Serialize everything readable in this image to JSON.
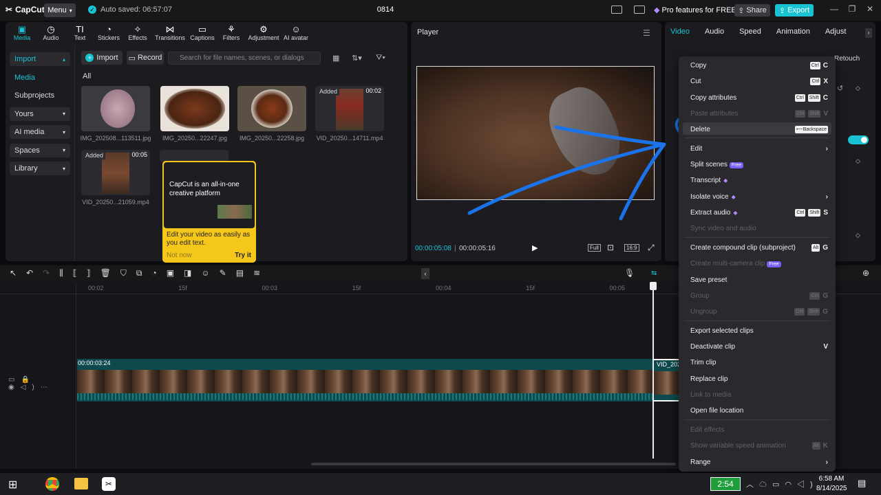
{
  "titlebar": {
    "logo": "CapCut",
    "menu_label": "Menu",
    "autosave": "Auto saved: 06:57:07",
    "project_name": "0814",
    "pro_features": "Pro features for FREE",
    "share": "Share",
    "export": "Export"
  },
  "tools": [
    {
      "label": "Media",
      "icon": "media-icon"
    },
    {
      "label": "Audio",
      "icon": "audio-icon"
    },
    {
      "label": "Text",
      "icon": "text-icon"
    },
    {
      "label": "Stickers",
      "icon": "stickers-icon"
    },
    {
      "label": "Effects",
      "icon": "effects-icon"
    },
    {
      "label": "Transitions",
      "icon": "transitions-icon"
    },
    {
      "label": "Captions",
      "icon": "captions-icon"
    },
    {
      "label": "Filters",
      "icon": "filters-icon"
    },
    {
      "label": "Adjustment",
      "icon": "adjustment-icon"
    },
    {
      "label": "AI avatar",
      "icon": "ai-avatar-icon"
    }
  ],
  "sidebar": {
    "items": [
      "Import",
      "Media",
      "Subprojects",
      "Yours",
      "AI media",
      "Spaces",
      "Library"
    ]
  },
  "media": {
    "import": "Import",
    "record": "Record",
    "search_placeholder": "Search for file names, scenes, or dialogs",
    "all": "All",
    "files": [
      {
        "name": "IMG_202508...113511.jpg",
        "added": "",
        "duration": ""
      },
      {
        "name": "IMG_20250...22247.jpg",
        "added": "",
        "duration": ""
      },
      {
        "name": "IMG_20250...22258.jpg",
        "added": "",
        "duration": ""
      },
      {
        "name": "VID_20250...14711.mp4",
        "added": "Added",
        "duration": "00:02"
      },
      {
        "name": "VID_20250...21059.mp4",
        "added": "Added",
        "duration": "00:05"
      }
    ]
  },
  "tooltip": {
    "headline": "CapCut is an all-in-one creative platform",
    "body": "Edit your video as easily as you edit text.",
    "not_now": "Not now",
    "try_it": "Try it"
  },
  "player": {
    "title": "Player",
    "current": "00:00:05:08",
    "total": "00:00:05:16",
    "full": "Full",
    "ratio": "16:9"
  },
  "props": {
    "tabs": [
      "Video",
      "Audio",
      "Speed",
      "Animation",
      "Adjust"
    ],
    "retouch": "Retouch"
  },
  "timeline": {
    "ruler": [
      "00:02",
      "15f",
      "00:03",
      "15f",
      "00:04",
      "15f",
      "00:05"
    ],
    "clip_time": "00:00:03:24",
    "clip2_label": "VID_202"
  },
  "context_menu": [
    {
      "label": "Copy",
      "keys": [
        "Ctrl"
      ],
      "letter": "C",
      "disabled": false
    },
    {
      "label": "Cut",
      "keys": [
        "Ctrl"
      ],
      "letter": "X",
      "disabled": false
    },
    {
      "label": "Copy attributes",
      "keys": [
        "Ctrl",
        "Shift"
      ],
      "letter": "C",
      "disabled": false
    },
    {
      "label": "Paste attributes",
      "keys": [
        "Ctrl",
        "Shift"
      ],
      "letter": "V",
      "disabled": true
    },
    {
      "label": "Delete",
      "keys": [
        "⟵Backspace"
      ],
      "letter": "",
      "disabled": false
    },
    {
      "label": "Edit",
      "keys": [],
      "letter": "›",
      "disabled": false
    },
    {
      "label": "Split scenes",
      "badge": "Free",
      "keys": [],
      "letter": "",
      "disabled": false
    },
    {
      "label": "Transcript",
      "badge": "◆",
      "keys": [],
      "letter": "",
      "disabled": false
    },
    {
      "label": "Isolate voice",
      "badge": "◆",
      "keys": [],
      "letter": "›",
      "disabled": false
    },
    {
      "label": "Extract audio",
      "badge": "◆",
      "keys": [
        "Ctrl",
        "Shift"
      ],
      "letter": "S",
      "disabled": false
    },
    {
      "label": "Sync video and audio",
      "keys": [],
      "letter": "",
      "disabled": true
    },
    {
      "label": "Create compound clip (subproject)",
      "keys": [
        "Alt"
      ],
      "letter": "G",
      "disabled": false
    },
    {
      "label": "Create multi-camera clip",
      "badge": "Free",
      "keys": [],
      "letter": "",
      "disabled": true
    },
    {
      "label": "Save preset",
      "keys": [],
      "letter": "",
      "disabled": false
    },
    {
      "label": "Group",
      "keys": [
        "Ctrl"
      ],
      "letter": "G",
      "disabled": true
    },
    {
      "label": "Ungroup",
      "keys": [
        "Ctrl",
        "Shift"
      ],
      "letter": "G",
      "disabled": true
    },
    {
      "label": "Export selected clips",
      "keys": [],
      "letter": "",
      "disabled": false
    },
    {
      "label": "Deactivate clip",
      "keys": [],
      "letter": "V",
      "disabled": false
    },
    {
      "label": "Trim clip",
      "keys": [],
      "letter": "",
      "disabled": false
    },
    {
      "label": "Replace clip",
      "keys": [],
      "letter": "",
      "disabled": false
    },
    {
      "label": "Link to media",
      "keys": [],
      "letter": "",
      "disabled": true
    },
    {
      "label": "Open file location",
      "keys": [],
      "letter": "",
      "disabled": false
    },
    {
      "label": "Edit effects",
      "keys": [],
      "letter": "",
      "disabled": true
    },
    {
      "label": "Show variable speed animation",
      "keys": [
        "Alt"
      ],
      "letter": "K",
      "disabled": true
    },
    {
      "label": "Range",
      "keys": [],
      "letter": "›",
      "disabled": false
    }
  ],
  "taskbar": {
    "timer": "2:54",
    "time": "6:58 AM",
    "date": "8/14/2025"
  },
  "colors": {
    "accent": "#19c3d1",
    "annotation": "#1a73e8"
  }
}
